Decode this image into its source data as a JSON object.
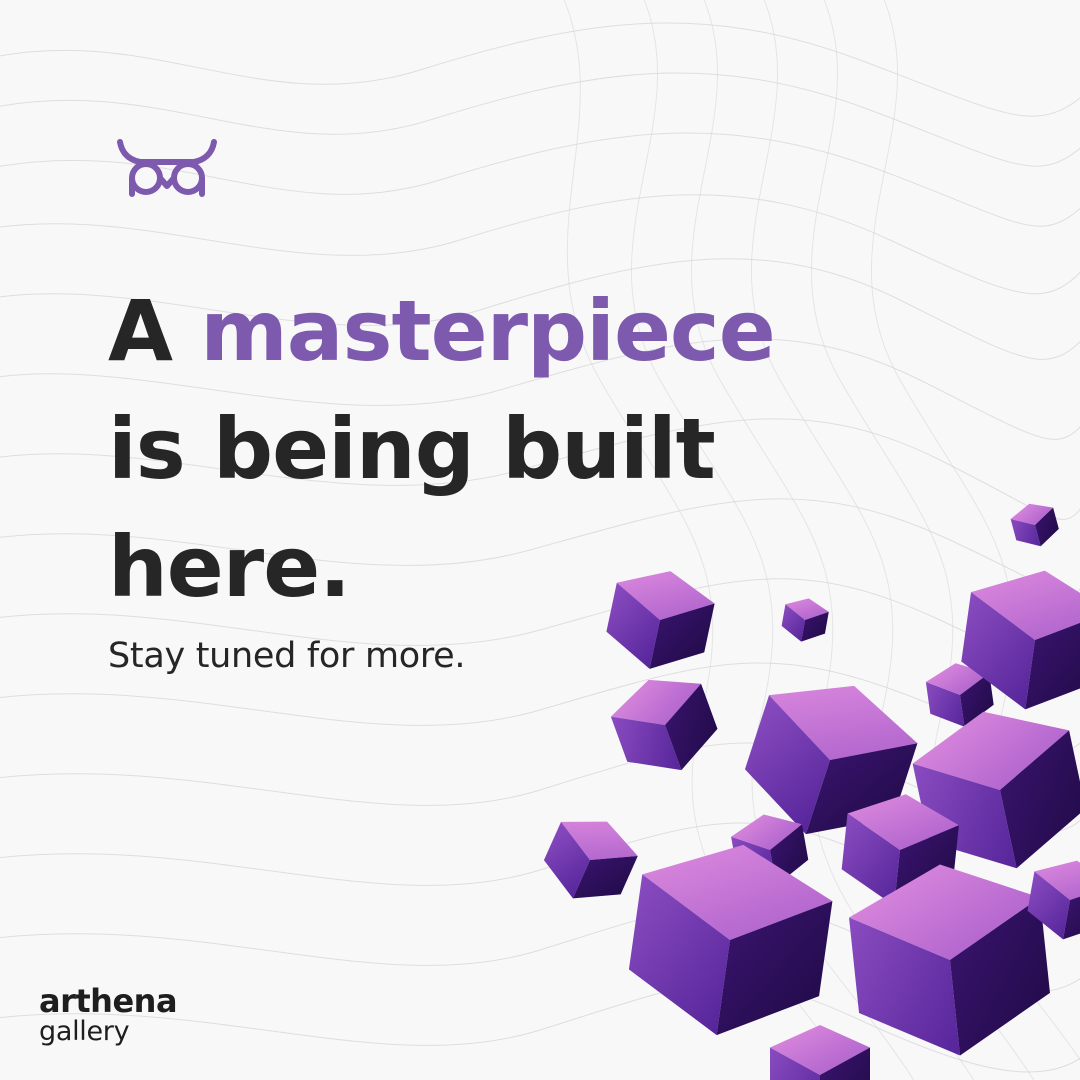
{
  "headline": {
    "line1_prefix": "A",
    "line1_accent": "masterpiece",
    "line2": "is being built",
    "line3": "here."
  },
  "subtitle": "Stay tuned for more.",
  "brand": {
    "name": "arthena",
    "sub": "gallery"
  },
  "icons": {
    "logo": "owl-mask-icon",
    "decoration": "purple-cubes-illustration"
  },
  "colors": {
    "accent": "#7d5aad",
    "text": "#262626",
    "background": "#f8f8f9",
    "cube": "#7a3fb0"
  }
}
